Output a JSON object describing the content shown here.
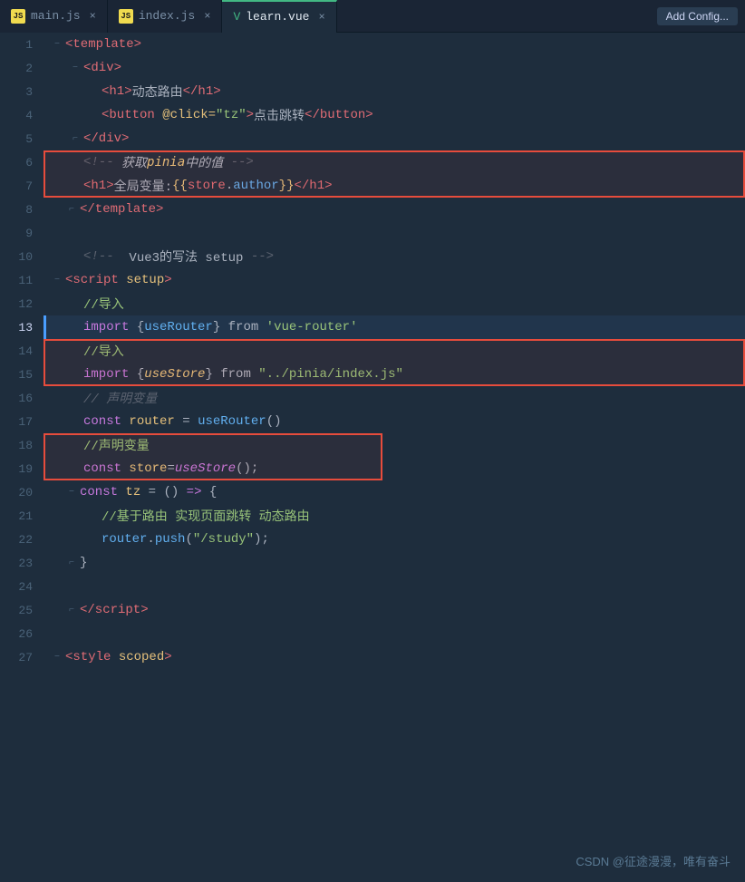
{
  "tabs": [
    {
      "id": "main-js",
      "label": "main.js",
      "icon": "js",
      "active": false
    },
    {
      "id": "index-js",
      "label": "index.js",
      "icon": "js",
      "active": false
    },
    {
      "id": "learn-vue",
      "label": "learn.vue",
      "icon": "vue",
      "active": true
    }
  ],
  "add_config_label": "Add Config...",
  "lines": [
    {
      "num": 1,
      "indent": 0,
      "fold": "open",
      "content": "&lt;template&gt;"
    },
    {
      "num": 2,
      "indent": 1,
      "fold": "open",
      "content": "&lt;div&gt;"
    },
    {
      "num": 3,
      "indent": 2,
      "fold": null,
      "content": "&lt;h1&gt;动态路由&lt;/h1&gt;"
    },
    {
      "num": 4,
      "indent": 2,
      "fold": null,
      "content": "&lt;button @click=\"tz\"&gt;点击跳转&lt;/button&gt;"
    },
    {
      "num": 5,
      "indent": 1,
      "fold": "close",
      "content": "&lt;/div&gt;"
    },
    {
      "num": 6,
      "indent": 1,
      "fold": null,
      "content": "&lt;!-- 获取pinia中的值 --&gt;",
      "highlight_start": true
    },
    {
      "num": 7,
      "indent": 1,
      "fold": null,
      "content": "&lt;h1&gt;全局变量:{{store.author}}&lt;/h1&gt;",
      "highlight_end": true
    },
    {
      "num": 8,
      "indent": 0,
      "fold": "close",
      "content": "&lt;/template&gt;"
    },
    {
      "num": 9,
      "indent": 0,
      "fold": null,
      "content": ""
    },
    {
      "num": 10,
      "indent": 0,
      "fold": null,
      "content": "&lt;!-- Vue3的写法 setup --&gt;"
    },
    {
      "num": 11,
      "indent": 0,
      "fold": "open",
      "content": "&lt;script setup&gt;"
    },
    {
      "num": 12,
      "indent": 1,
      "fold": null,
      "content": "//导入"
    },
    {
      "num": 13,
      "indent": 1,
      "fold": null,
      "content": "import {useRouter} from 'vue-router'",
      "active": true
    },
    {
      "num": 14,
      "indent": 1,
      "fold": null,
      "content": "//导入",
      "highlight_start": true
    },
    {
      "num": 15,
      "indent": 1,
      "fold": null,
      "content": "import {useStore} from \"../pinia/index.js\"",
      "highlight_end": true
    },
    {
      "num": 16,
      "indent": 1,
      "fold": null,
      "content": "// 声明变量"
    },
    {
      "num": 17,
      "indent": 1,
      "fold": null,
      "content": "const router = useRouter()"
    },
    {
      "num": 18,
      "indent": 1,
      "fold": null,
      "content": "//声明变量",
      "highlight_start": true
    },
    {
      "num": 19,
      "indent": 1,
      "fold": null,
      "content": "const store=useStore();",
      "highlight_end": true
    },
    {
      "num": 20,
      "indent": 1,
      "fold": "open",
      "content": "const tz = () => {"
    },
    {
      "num": 21,
      "indent": 2,
      "fold": null,
      "content": "//基于路由 实现页面跳转 动态路由"
    },
    {
      "num": 22,
      "indent": 2,
      "fold": null,
      "content": "router.push(\"/study\");"
    },
    {
      "num": 23,
      "indent": 1,
      "fold": "close",
      "content": "}"
    },
    {
      "num": 24,
      "indent": 0,
      "fold": null,
      "content": ""
    },
    {
      "num": 25,
      "indent": 0,
      "fold": "close",
      "content": "&lt;/script&gt;"
    },
    {
      "num": 26,
      "indent": 0,
      "fold": null,
      "content": ""
    },
    {
      "num": 27,
      "indent": 0,
      "fold": "open",
      "content": "&lt;style scoped&gt;"
    }
  ],
  "watermark": "CSDN @征途漫漫，唯有奋斗"
}
